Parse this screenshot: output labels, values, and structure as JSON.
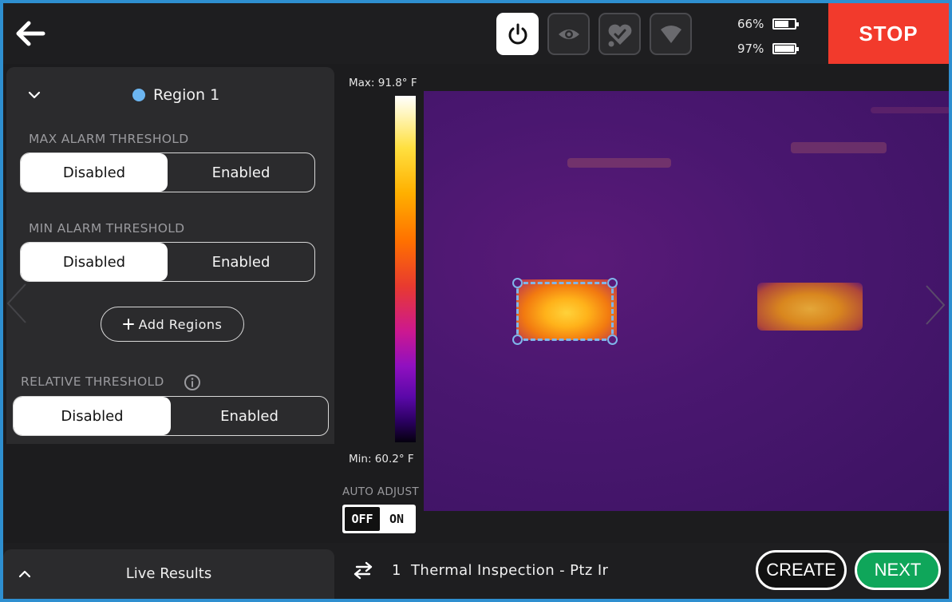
{
  "topbar": {
    "back_icon": "arrow-left-icon",
    "icons": [
      "power-icon",
      "eye-icon",
      "heart-check-icon",
      "wifi-icon"
    ],
    "battery_1": {
      "percent_label": "66%",
      "level": 0.66
    },
    "battery_2": {
      "percent_label": "97%",
      "level": 0.97
    },
    "stop_label": "STOP"
  },
  "region": {
    "title": "Region 1",
    "dot_color": "#6cb5f0",
    "max_alarm": {
      "label": "MAX ALARM THRESHOLD",
      "options": [
        "Disabled",
        "Enabled"
      ],
      "selected": "Disabled"
    },
    "min_alarm": {
      "label": "MIN ALARM THRESHOLD",
      "options": [
        "Disabled",
        "Enabled"
      ],
      "selected": "Disabled"
    },
    "add_regions_label": "Add Regions",
    "relative": {
      "label": "RELATIVE THRESHOLD",
      "options": [
        "Disabled",
        "Enabled"
      ],
      "selected": "Disabled"
    }
  },
  "live_results": {
    "label": "Live Results"
  },
  "colorbar": {
    "max_label": "Max: 91.8° F",
    "min_label": "Min: 60.2° F",
    "auto_adjust_label": "AUTO ADJUST",
    "toggle_off": "OFF",
    "toggle_on": "ON"
  },
  "bottombar": {
    "inspection_number": "1",
    "inspection_name": "Thermal Inspection - Ptz Ir",
    "create_label": "CREATE",
    "next_label": "NEXT"
  },
  "colors": {
    "stop": "#f23a2c",
    "next": "#0fa65a",
    "roi": "#7fb6ea",
    "frame": "#2e8fd0"
  }
}
